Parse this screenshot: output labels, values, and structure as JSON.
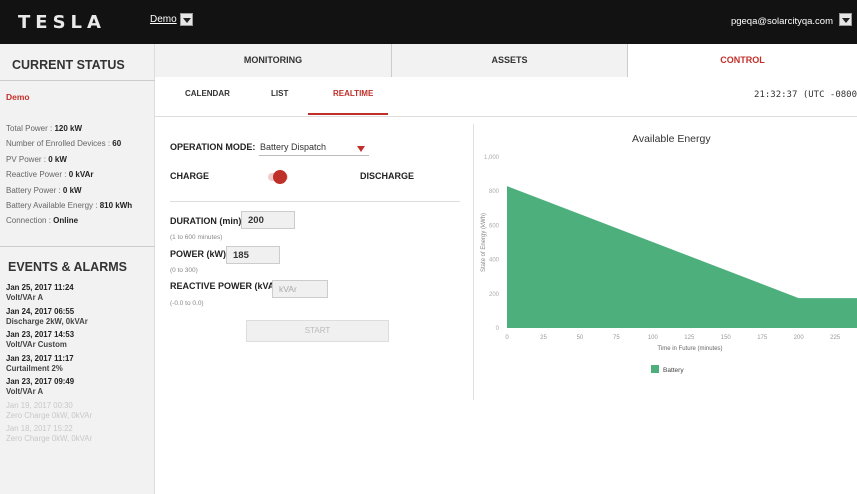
{
  "header": {
    "logo": "TESLA",
    "site_select": "Demo",
    "user": "pgeqa@solarcityqa.com"
  },
  "status": {
    "title": "CURRENT STATUS",
    "site": "Demo",
    "rows": [
      {
        "label": "Total Power : ",
        "value": "120 kW"
      },
      {
        "label": "Number of Enrolled Devices : ",
        "value": "60"
      },
      {
        "label": "PV Power : ",
        "value": "0 kW"
      },
      {
        "label": "Reactive Power : ",
        "value": "0 kVAr"
      },
      {
        "label": "Battery Power : ",
        "value": "0 kW"
      },
      {
        "label": "Battery Available Energy : ",
        "value": "810 kWh"
      },
      {
        "label": "Connection : ",
        "value": "Online"
      }
    ]
  },
  "events": {
    "title": "EVENTS & ALARMS",
    "items": [
      {
        "date": "Jan 25, 2017 11:24",
        "text": "Volt/VAr A"
      },
      {
        "date": "Jan 24, 2017 06:55",
        "text": "Discharge 2kW, 0kVAr"
      },
      {
        "date": "Jan 23, 2017 14:53",
        "text": "Volt/VAr Custom"
      },
      {
        "date": "Jan 23, 2017 11:17",
        "text": "Curtailment 2%"
      },
      {
        "date": "Jan 23, 2017 09:49",
        "text": "Volt/VAr A"
      },
      {
        "date": "Jan 19, 2017 00:30",
        "text": "Zero Charge 0kW, 0kVAr"
      },
      {
        "date": "Jan 18, 2017 15:22",
        "text": "Zero Charge 0kW, 0kVAr"
      }
    ]
  },
  "tabs": {
    "monitoring": "MONITORING",
    "assets": "ASSETS",
    "control": "CONTROL"
  },
  "subtabs": {
    "calendar": "CALENDAR",
    "list": "LIST",
    "realtime": "REALTIME"
  },
  "clock": "21:32:37 (UTC -0800",
  "form": {
    "mode_label": "OPERATION MODE:",
    "mode_value": "Battery Dispatch",
    "charge": "CHARGE",
    "discharge": "DISCHARGE",
    "duration_label": "DURATION (min):",
    "duration_value": "200",
    "duration_hint": "(1 to 600 minutes)",
    "power_label": "POWER (kW):",
    "power_value": "185",
    "power_hint": "(0 to 300)",
    "reactive_label": "REACTIVE POWER (kVAr):",
    "reactive_placeholder": "kVAr",
    "reactive_hint": "(-0.0 to 0.0)",
    "start": "START"
  },
  "colors": {
    "accent": "#c0302a",
    "battery": "#4caf7c"
  },
  "chart_data": {
    "type": "area",
    "title": "Available Energy",
    "xlabel": "Time in Future (minutes)",
    "ylabel": "State of Energy (kWh)",
    "x_ticks": [
      0,
      25,
      50,
      75,
      100,
      125,
      150,
      175,
      200,
      225
    ],
    "y_ticks": [
      0,
      200,
      400,
      600,
      800,
      1000
    ],
    "y_tick_labels": [
      "0",
      "200",
      "400",
      "600",
      "800",
      "1,000"
    ],
    "xlim": [
      0,
      240
    ],
    "ylim": [
      0,
      1000
    ],
    "series": [
      {
        "name": "Battery",
        "x": [
          0,
          200,
          240
        ],
        "y": [
          830,
          175,
          175
        ]
      }
    ],
    "legend": "bottom"
  }
}
